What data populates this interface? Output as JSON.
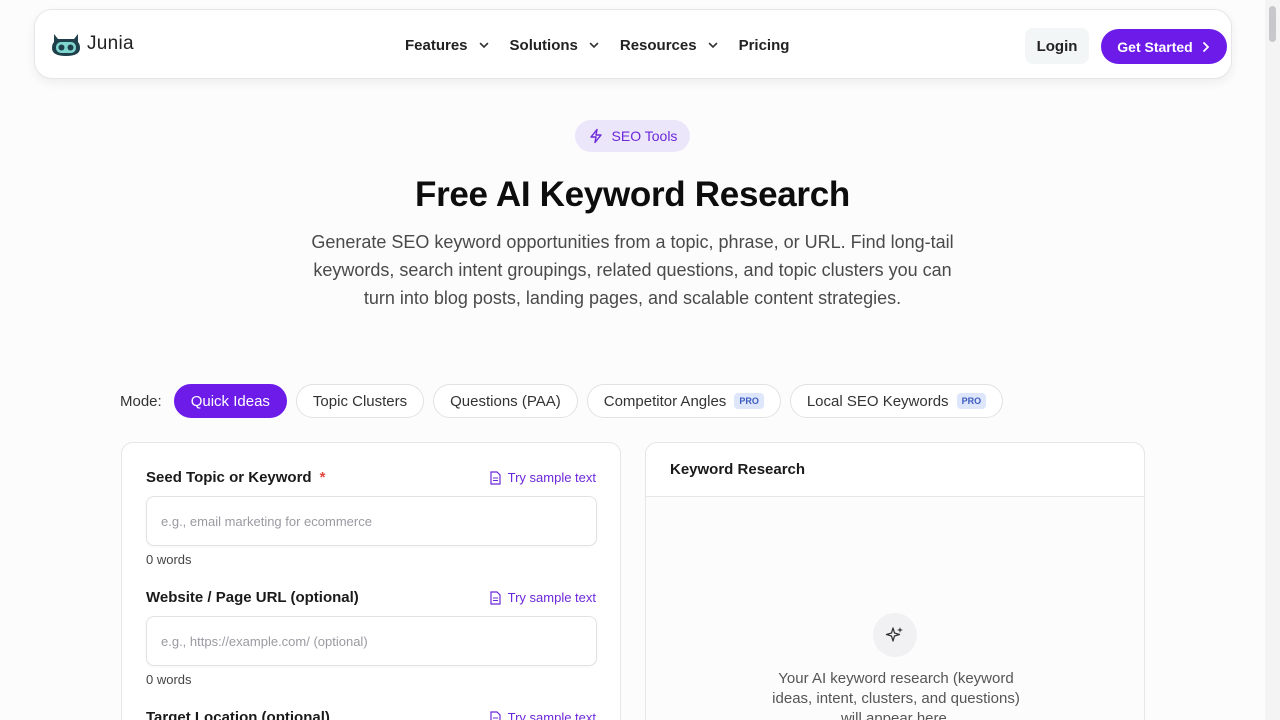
{
  "nav": {
    "brand": "Junia",
    "items": [
      {
        "label": "Features",
        "dropdown": true
      },
      {
        "label": "Solutions",
        "dropdown": true
      },
      {
        "label": "Resources",
        "dropdown": true
      },
      {
        "label": "Pricing",
        "dropdown": false
      }
    ],
    "login": "Login",
    "get_started": "Get Started"
  },
  "hero": {
    "badge": "SEO Tools",
    "title": "Free AI Keyword Research",
    "subtitle": "Generate SEO keyword opportunities from a topic, phrase, or URL. Find long-tail keywords, search intent groupings, related questions, and topic clusters you can turn into blog posts, landing pages, and scalable content strategies."
  },
  "mode": {
    "label": "Mode:",
    "options": [
      {
        "label": "Quick Ideas",
        "active": true,
        "pro": false
      },
      {
        "label": "Topic Clusters",
        "active": false,
        "pro": false
      },
      {
        "label": "Questions (PAA)",
        "active": false,
        "pro": false
      },
      {
        "label": "Competitor Angles",
        "active": false,
        "pro": true
      },
      {
        "label": "Local SEO Keywords",
        "active": false,
        "pro": true
      }
    ],
    "pro_label": "PRO"
  },
  "form": {
    "sample_label": "Try sample text",
    "seed": {
      "label": "Seed Topic or Keyword",
      "required_mark": "*",
      "placeholder": "e.g., email marketing for ecommerce",
      "value": "",
      "words": "0 words"
    },
    "url": {
      "label": "Website / Page URL (optional)",
      "placeholder": "e.g., https://example.com/ (optional)",
      "value": "",
      "words": "0 words"
    },
    "location": {
      "label": "Target Location (optional)"
    }
  },
  "results": {
    "title": "Keyword Research",
    "empty": "Your AI keyword research (keyword ideas, intent, clusters, and questions) will appear here."
  },
  "colors": {
    "accent": "#6d1be8",
    "badge_bg": "#ece6fb",
    "pro_bg": "#dde6fb"
  }
}
